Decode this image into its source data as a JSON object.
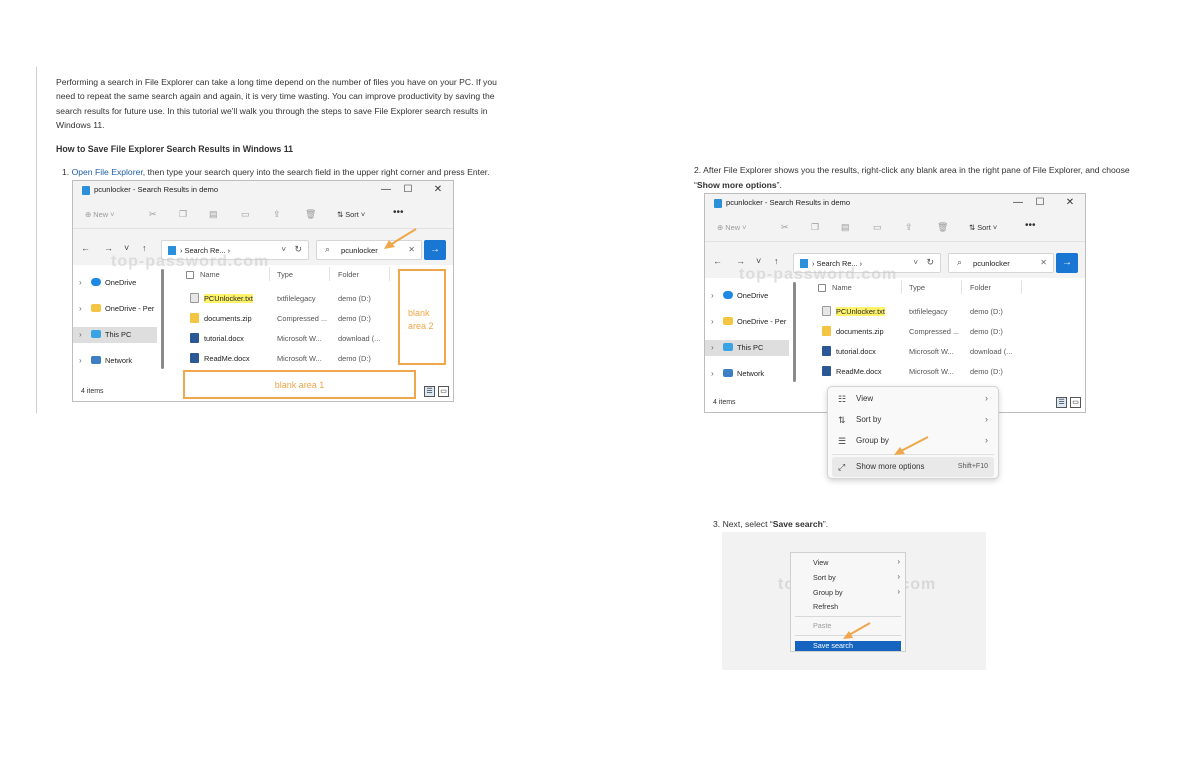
{
  "article": {
    "intro": "Performing a search in File Explorer can take a long time depend on the number of files you have on your PC. If you need to repeat the same search again and again, it is very time wasting. You can improve productivity by saving the search results for future use. In this tutorial we'll walk you through the steps to save File Explorer search results in Windows 11.",
    "heading": "How to Save File Explorer Search Results in Windows 11",
    "step1_num": "1.",
    "step1_link": "Open File Explorer",
    "step1_rest": ", then type your search query into the search field in the upper right corner and press Enter.",
    "step2_num": "2.",
    "step2_text": "After File Explorer shows you the results, right-click any blank area in the right pane of File Explorer, and choose “",
    "step2_bold": "Show more options",
    "step2_end": "”.",
    "step3_num": "3.",
    "step3_text": "Next, select “",
    "step3_bold": "Save search",
    "step3_end": "”."
  },
  "explorer": {
    "title": "pcunlocker - Search Results in demo",
    "minimize": "—",
    "maximize": "☐",
    "close": "✕",
    "new_label": "New",
    "sort_label": "Sort",
    "more": "•••",
    "address": "Search Re...",
    "search_value": "pcunlocker",
    "nav_back": "←",
    "nav_forward": "→",
    "nav_down": "˅",
    "nav_up": "↑",
    "refresh": "↻",
    "go": "→",
    "sidebar": [
      {
        "label": "OneDrive",
        "icon": "cloud-icon"
      },
      {
        "label": "OneDrive - Per",
        "icon": "folder-icon"
      },
      {
        "label": "This PC",
        "icon": "pc-icon"
      },
      {
        "label": "Network",
        "icon": "network-icon"
      }
    ],
    "columns": [
      "Name",
      "Type",
      "Folder"
    ],
    "files": [
      {
        "name": "PCUnlocker.txt",
        "type": "txtfilelegacy",
        "folder": "demo (D:)",
        "icon": "text-file-icon"
      },
      {
        "name": "documents.zip",
        "type": "Compressed ...",
        "folder": "demo (D:)",
        "icon": "zip-folder-icon"
      },
      {
        "name": "tutorial.docx",
        "type": "Microsoft W...",
        "folder": "download (...",
        "icon": "word-doc-icon"
      },
      {
        "name": "ReadMe.docx",
        "type": "Microsoft W...",
        "folder": "demo (D:)",
        "icon": "word-doc-icon"
      }
    ],
    "status": "4 items",
    "watermark": "top-password.com"
  },
  "annotations": {
    "blank1": "blank area 1",
    "blank2": "blank area 2"
  },
  "context_menu": [
    {
      "label": "View",
      "icon": "☷",
      "arrow": "›"
    },
    {
      "label": "Sort by",
      "icon": "⇅",
      "arrow": "›"
    },
    {
      "label": "Group by",
      "icon": "☰",
      "arrow": "›"
    },
    {
      "label": "Show more options",
      "icon": "⤢",
      "shortcut": "Shift+F10"
    }
  ],
  "classic_menu": {
    "items": [
      "View",
      "Sort by",
      "Group by",
      "Refresh"
    ],
    "paste": "Paste",
    "save": "Save search",
    "arrow": "›"
  },
  "colors": {
    "accent": "#1976d2",
    "annotation": "#f0a64a",
    "highlight": "#fff36b",
    "link": "#1f5fa8"
  }
}
